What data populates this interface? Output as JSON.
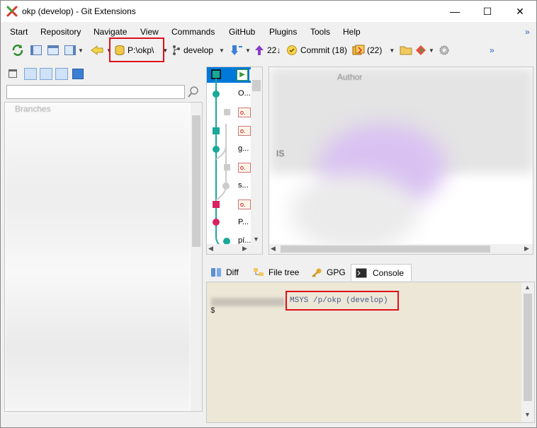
{
  "window": {
    "title": "okp (develop) - Git Extensions",
    "minimize": "—",
    "maximize": "☐",
    "close": "✕"
  },
  "menu": {
    "items": [
      "Start",
      "Repository",
      "Navigate",
      "View",
      "Commands",
      "GitHub",
      "Plugins",
      "Tools",
      "Help"
    ],
    "overflow": "»"
  },
  "toolbar": {
    "repo_path": "P:\\okp\\",
    "branch": "develop",
    "push_count": "22↓",
    "commit_label": "Commit (18)",
    "stash_label": "(22)",
    "overflow": "»"
  },
  "left_panel": {
    "tree_header": "Branches"
  },
  "graph": {
    "tags": [
      "o.",
      "o.",
      "o.",
      "o."
    ],
    "rows": [
      "O...",
      "g...",
      "s...",
      "P...",
      "pí..."
    ]
  },
  "revinfo": {
    "author_label": "Author",
    "left_label": "IS"
  },
  "tabs": {
    "diff": "Diff",
    "file_tree": "File tree",
    "gpg": "GPG",
    "console": "Console"
  },
  "console": {
    "prompt_prefix": "MSYS /p/okp (develop)",
    "prompt_symbol": "$"
  },
  "colors": {
    "highlight": "#e0101a",
    "graph_teal": "#1aa89a",
    "graph_pink": "#d9225f",
    "selected_row": "#0078d7",
    "console_bg": "#ede7d8",
    "console_text": "#4a5a8a"
  }
}
